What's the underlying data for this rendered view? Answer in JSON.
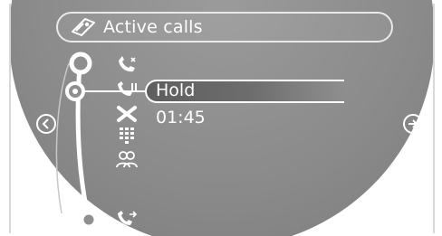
{
  "header": {
    "title": "Active calls",
    "icon": "mobile-phone-icon"
  },
  "calls_list": {
    "items": [
      {
        "icon": "call-icon",
        "selected": false
      },
      {
        "icon": "hold-call-icon",
        "selected": true,
        "label": "Hold"
      },
      {
        "icon": "end-call-icon",
        "selected": false
      },
      {
        "icon": "keypad-icon",
        "selected": false
      },
      {
        "icon": "conference-call-icon",
        "selected": false
      },
      {
        "icon": "call-transfer-icon",
        "selected": false
      }
    ]
  },
  "selected_action": {
    "label": "Hold",
    "duration": "01:45"
  },
  "navigation": {
    "left_icon": "arrow-left-icon",
    "right_icon": "arrow-right-icon"
  },
  "colors": {
    "display_background": "#8a8a8a",
    "foreground": "#ffffff",
    "highlight": "#5e5e5e"
  }
}
